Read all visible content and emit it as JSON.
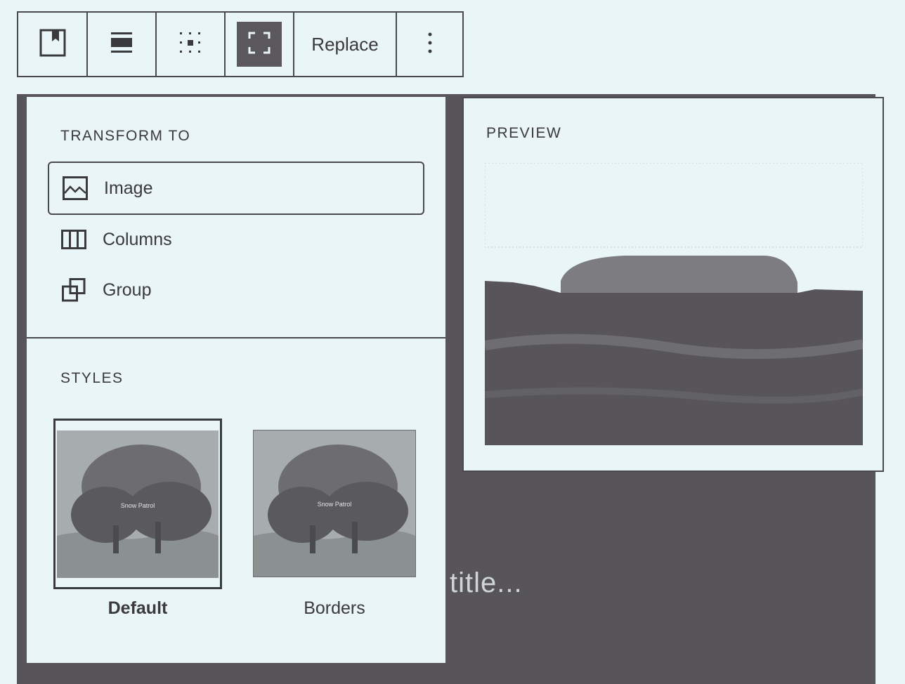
{
  "toolbar": {
    "buttons": [
      {
        "name": "block-type-cover",
        "icon": "cover-bookmark-icon"
      },
      {
        "name": "align",
        "icon": "align-full-icon"
      },
      {
        "name": "position",
        "icon": "position-grid-icon"
      },
      {
        "name": "fullscreen",
        "icon": "fullscreen-icon",
        "active": true
      }
    ],
    "replace_label": "Replace",
    "more_icon": "more-vertical-icon"
  },
  "transform": {
    "title": "TRANSFORM TO",
    "items": [
      {
        "label": "Image",
        "icon": "image-icon",
        "selected": true
      },
      {
        "label": "Columns",
        "icon": "columns-icon"
      },
      {
        "label": "Group",
        "icon": "group-icon"
      }
    ]
  },
  "styles": {
    "title": "STYLES",
    "items": [
      {
        "label": "Default",
        "selected": true,
        "thumb_text": "Snow Patrol"
      },
      {
        "label": "Borders",
        "selected": false,
        "thumb_text": "Snow Patrol"
      }
    ]
  },
  "preview": {
    "title": "PREVIEW"
  },
  "cover": {
    "placeholder": "title..."
  },
  "colors": {
    "background": "#eaf5f7",
    "dark": "#57555a",
    "text": "#3a393c"
  }
}
